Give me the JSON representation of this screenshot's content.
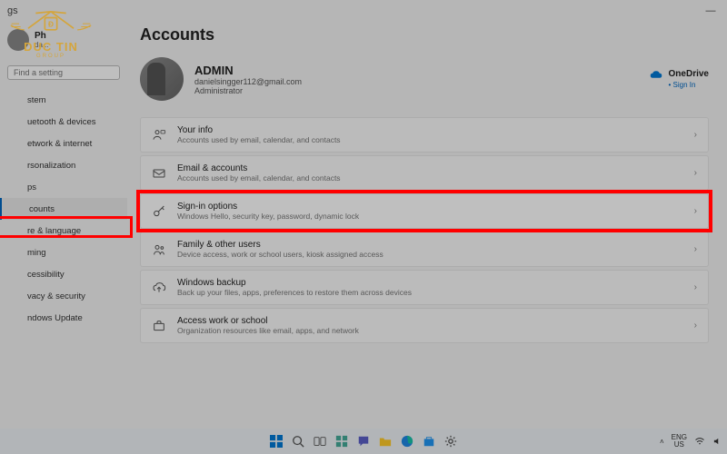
{
  "titlebar": {
    "app": "gs"
  },
  "page": {
    "title": "Accounts"
  },
  "profile_small": {
    "name": "Ph",
    "email": "da..."
  },
  "search": {
    "placeholder": "Find a setting"
  },
  "sidebar": {
    "items": [
      {
        "label": "stem"
      },
      {
        "label": "uetooth & devices"
      },
      {
        "label": "etwork & internet"
      },
      {
        "label": "rsonalization"
      },
      {
        "label": "ps"
      },
      {
        "label": "counts"
      },
      {
        "label": "re & language"
      },
      {
        "label": "ming"
      },
      {
        "label": "cessibility"
      },
      {
        "label": "vacy & security"
      },
      {
        "label": "ndows Update"
      }
    ]
  },
  "hero": {
    "name": "ADMIN",
    "email": "danielsingger112@gmail.com",
    "role": "Administrator",
    "onedrive": {
      "title": "OneDrive",
      "sub": "• Sign In"
    }
  },
  "cards": [
    {
      "icon": "person",
      "title": "Your info",
      "sub": "Accounts used by email, calendar, and contacts"
    },
    {
      "icon": "mail",
      "title": "Email & accounts",
      "sub": "Accounts used by email, calendar, and contacts"
    },
    {
      "icon": "key",
      "title": "Sign-in options",
      "sub": "Windows Hello, security key, password, dynamic lock"
    },
    {
      "icon": "family",
      "title": "Family & other users",
      "sub": "Device access, work or school users, kiosk assigned access"
    },
    {
      "icon": "backup",
      "title": "Windows backup",
      "sub": "Back up your files, apps, preferences to restore them across devices"
    },
    {
      "icon": "work",
      "title": "Access work or school",
      "sub": "Organization resources like email, apps, and network"
    }
  ],
  "taskbar": {
    "lang": "ENG\nUS",
    "time": ""
  },
  "watermark": {
    "brand": "DUC TIN",
    "sub": "GROUP"
  }
}
